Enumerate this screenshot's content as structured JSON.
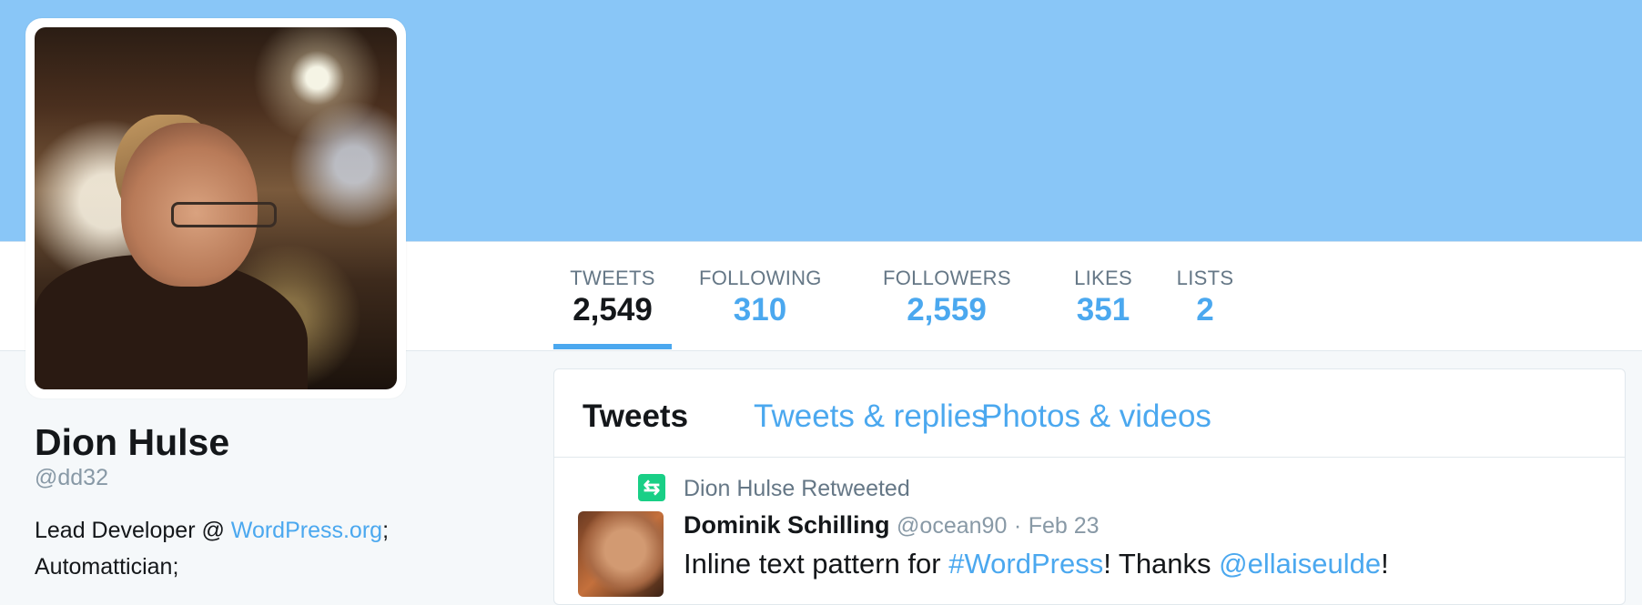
{
  "profile": {
    "name": "Dion Hulse",
    "handle": "@dd32",
    "bio_prefix": "Lead Developer @ ",
    "bio_link": "WordPress.org",
    "bio_suffix": ";",
    "bio_line2": "Automattician;"
  },
  "stats": [
    {
      "label": "TWEETS",
      "value": "2,549",
      "active": true
    },
    {
      "label": "FOLLOWING",
      "value": "310"
    },
    {
      "label": "FOLLOWERS",
      "value": "2,559"
    },
    {
      "label": "LIKES",
      "value": "351"
    },
    {
      "label": "LISTS",
      "value": "2"
    }
  ],
  "tabs": [
    {
      "label": "Tweets",
      "active": true
    },
    {
      "label": "Tweets & replies"
    },
    {
      "label": "Photos & videos"
    }
  ],
  "tweet": {
    "retweet_context": "Dion Hulse Retweeted",
    "author_name": "Dominik Schilling",
    "author_handle": "@ocean90",
    "separator": "·",
    "date": "Feb 23",
    "text_1": "Inline text pattern for ",
    "hashtag": "#WordPress",
    "text_2": "! Thanks ",
    "mention": "@ellaiseulde",
    "text_3": "!"
  },
  "icons": {
    "retweet": "retweet-icon"
  },
  "colors": {
    "banner": "#89c6f7",
    "accent": "#4ba8ef",
    "retweet": "#19cf86",
    "text": "#14171a",
    "muted": "#657786"
  }
}
